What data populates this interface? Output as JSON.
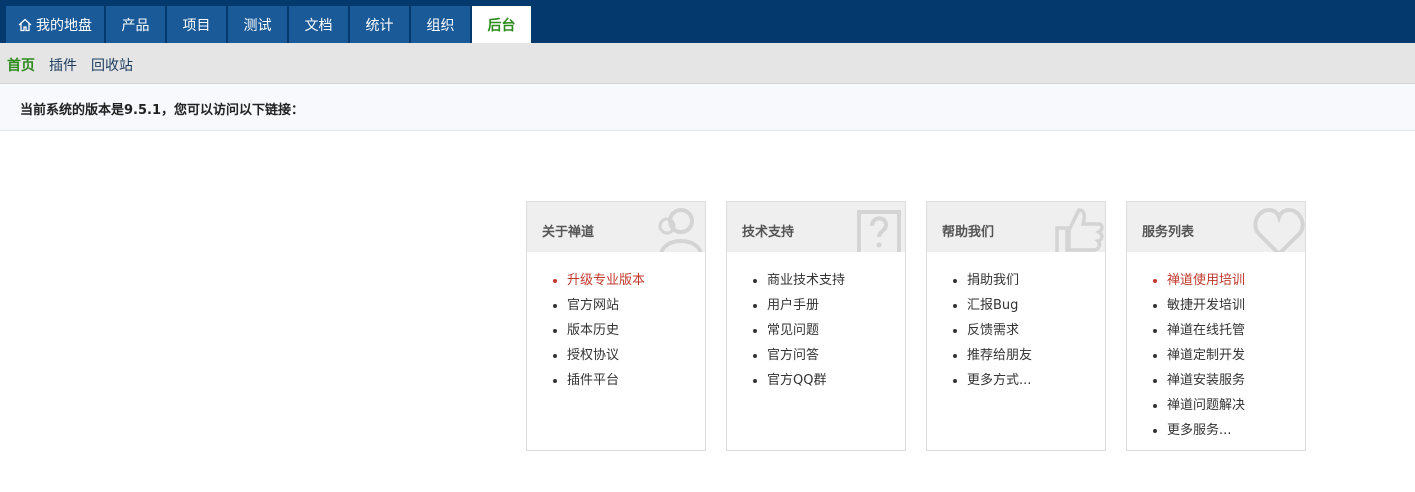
{
  "topnav": {
    "tabs": [
      {
        "label": "我的地盘",
        "active": false
      },
      {
        "label": "产品",
        "active": false
      },
      {
        "label": "项目",
        "active": false
      },
      {
        "label": "测试",
        "active": false
      },
      {
        "label": "文档",
        "active": false
      },
      {
        "label": "统计",
        "active": false
      },
      {
        "label": "组织",
        "active": false
      },
      {
        "label": "后台",
        "active": true
      }
    ]
  },
  "subnav": {
    "items": [
      {
        "label": "首页",
        "active": true
      },
      {
        "label": "插件",
        "active": false
      },
      {
        "label": "回收站",
        "active": false
      }
    ]
  },
  "info": {
    "text": "当前系统的版本是9.5.1，您可以访问以下链接："
  },
  "panels": [
    {
      "title": "关于禅道",
      "icon": "users-icon",
      "items": [
        "升级专业版本",
        "官方网站",
        "版本历史",
        "授权协议",
        "插件平台"
      ]
    },
    {
      "title": "技术支持",
      "icon": "help-icon",
      "items": [
        "商业技术支持",
        "用户手册",
        "常见问题",
        "官方问答",
        "官方QQ群"
      ]
    },
    {
      "title": "帮助我们",
      "icon": "thumbs-up-icon",
      "items": [
        "捐助我们",
        "汇报Bug",
        "反馈需求",
        "推荐给朋友",
        "更多方式..."
      ]
    },
    {
      "title": "服务列表",
      "icon": "heart-icon",
      "items": [
        "禅道使用培训",
        "敏捷开发培训",
        "禅道在线托管",
        "禅道定制开发",
        "禅道安装服务",
        "禅道问题解决",
        "更多服务..."
      ]
    }
  ],
  "colors": {
    "nav_bg": "#03396c",
    "tab_bg": "#1a5a98",
    "active_green": "#2e8b1e",
    "highlight_red": "#c0392b"
  }
}
